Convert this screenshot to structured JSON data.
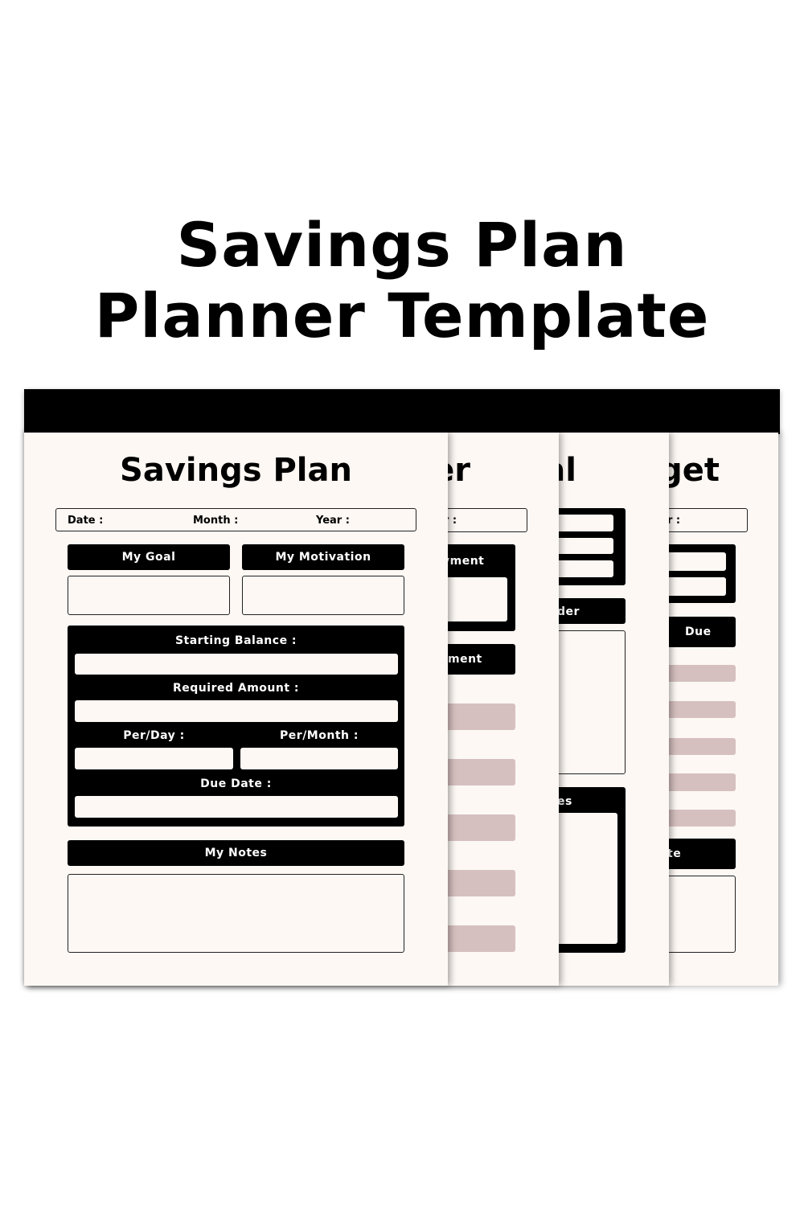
{
  "heading": {
    "line1": "Savings Plan",
    "line2": "Planner Template"
  },
  "colors": {
    "page": "#fdf8f4",
    "ink": "#000000",
    "accent_pink": "#d6c0bf"
  },
  "page4": {
    "title_fragment": "get",
    "date_fragment": "r :",
    "header_due": "Due",
    "header_fragment": "te"
  },
  "page3": {
    "title_fragment": "al",
    "header_fragment": "der",
    "box_fragment": "es"
  },
  "page2": {
    "title_fragment": "er",
    "date_fragment": "r :",
    "box_fragment": "yment",
    "header_fragment": "ment"
  },
  "front": {
    "title": "Savings Plan",
    "date_label": "Date :",
    "month_label": "Month :",
    "year_label": "Year :",
    "goal_label": "My Goal",
    "motivation_label": "My Motivation",
    "starting_balance_label": "Starting Balance :",
    "required_amount_label": "Required Amount :",
    "per_day_label": "Per/Day :",
    "per_month_label": "Per/Month :",
    "due_date_label": "Due Date :",
    "notes_label": "My Notes"
  }
}
